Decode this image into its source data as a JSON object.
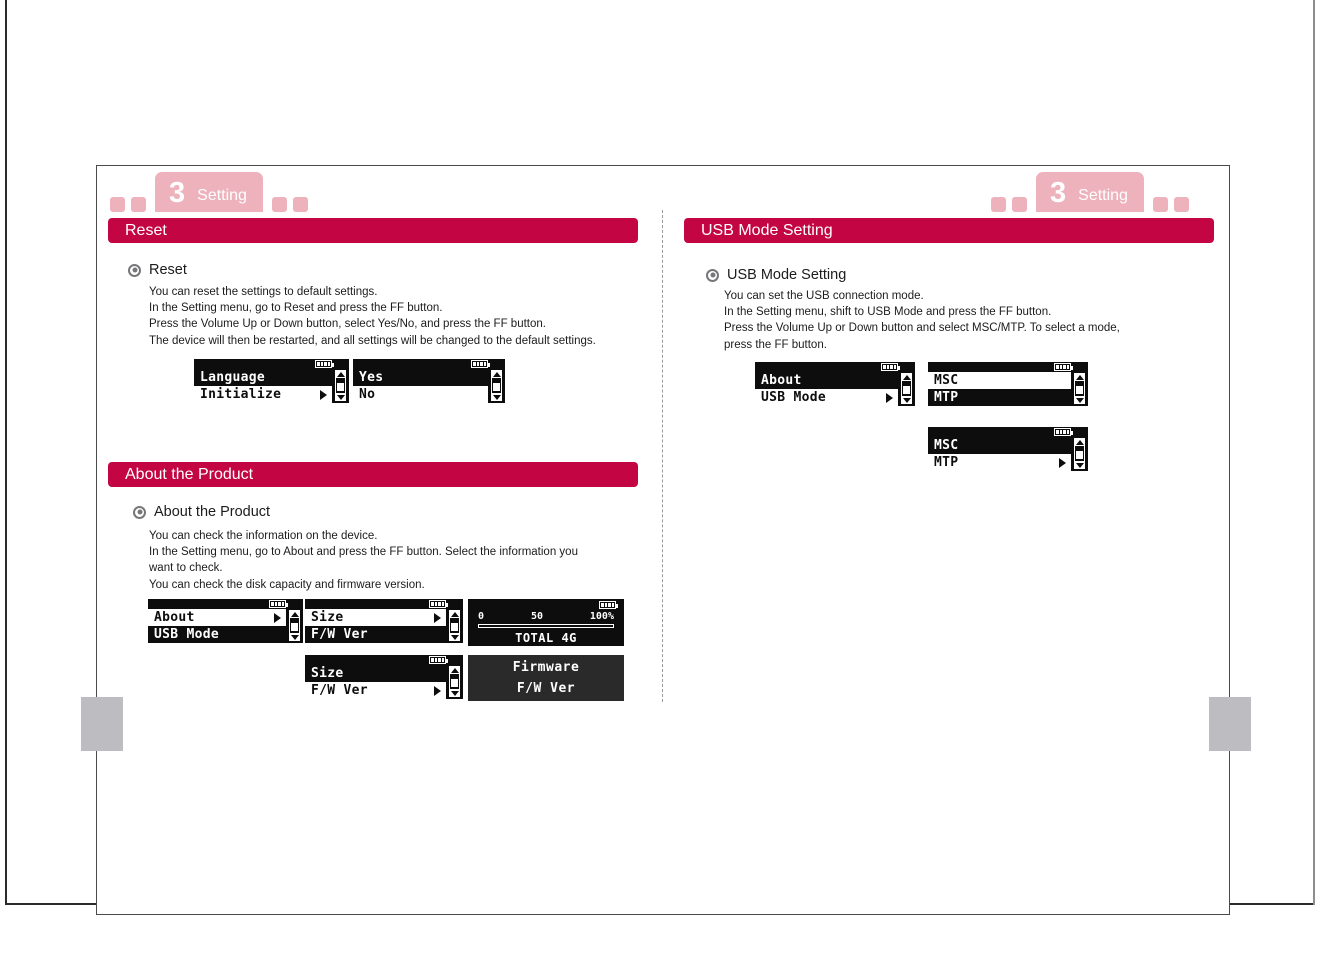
{
  "chapter": {
    "number": "3",
    "word": "Setting"
  },
  "sections": {
    "reset": {
      "banner": "Reset",
      "subhead": "Reset",
      "lines": [
        "You can reset the settings to default settings.",
        "In the Setting menu, go to Reset and press the FF button.",
        "Press the Volume Up or Down button, select Yes/No, and press the FF button.",
        "The device will then be restarted, and all settings will be changed to the default settings."
      ]
    },
    "about": {
      "banner": "About the Product",
      "subhead": "About the Product",
      "lines": [
        "You can check the information on the device.",
        "In the Setting menu, go to About and press the FF button. Select the information you want to check.",
        "You can check the disk capacity and firmware version."
      ]
    },
    "usb": {
      "banner": "USB Mode Setting",
      "subhead": "USB Mode Setting",
      "lines": [
        "You can set the USB connection mode.",
        "In the Setting menu, shift to USB Mode and press the FF button.",
        "Press the Volume Up or Down button and select MSC/MTP. To select a mode, press the FF button."
      ]
    }
  },
  "screens": {
    "language": {
      "rows": [
        {
          "label": "Language",
          "selected": false,
          "arrow": false
        },
        {
          "label": "Initialize",
          "selected": true,
          "arrow": true
        }
      ]
    },
    "yesno": {
      "rows": [
        {
          "label": "Yes",
          "selected": false,
          "arrow": false
        },
        {
          "label": "No",
          "selected": true,
          "arrow": false
        }
      ]
    },
    "about": {
      "rows": [
        {
          "label": "About",
          "selected": true,
          "arrow": true
        },
        {
          "label": "USB Mode",
          "selected": false,
          "arrow": false
        }
      ]
    },
    "size": {
      "rows": [
        {
          "label": "Size",
          "selected": true,
          "arrow": true
        },
        {
          "label": "F/W Ver",
          "selected": false,
          "arrow": false
        }
      ]
    },
    "size2": {
      "rows": [
        {
          "label": "Size",
          "selected": false,
          "arrow": false
        },
        {
          "label": "F/W Ver",
          "selected": true,
          "arrow": true
        }
      ]
    },
    "capacity": {
      "scale_min": "0",
      "scale_mid": "50",
      "scale_max": "100%",
      "fill_percent": 8,
      "total_label": "TOTAL 4G"
    },
    "firmware": {
      "line1": "Firmware",
      "line2": "F/W Ver"
    },
    "usb_about": {
      "rows": [
        {
          "label": "About",
          "selected": false,
          "arrow": false
        },
        {
          "label": "USB Mode",
          "selected": true,
          "arrow": true
        }
      ]
    },
    "msc_mtp_1": {
      "rows": [
        {
          "label": "MSC",
          "selected": true,
          "arrow": false
        },
        {
          "label": "MTP",
          "selected": false,
          "arrow": false
        }
      ]
    },
    "msc_mtp_2": {
      "rows": [
        {
          "label": "MSC",
          "selected": false,
          "arrow": false
        },
        {
          "label": "MTP",
          "selected": true,
          "arrow": true
        }
      ]
    }
  },
  "colors": {
    "banner": "#c30543",
    "chapter_tab": "#edb2bc",
    "lcd_background": "#0d0d0d",
    "lcd_text": "#ffffff",
    "corner_tab": "#bdbdc1"
  }
}
